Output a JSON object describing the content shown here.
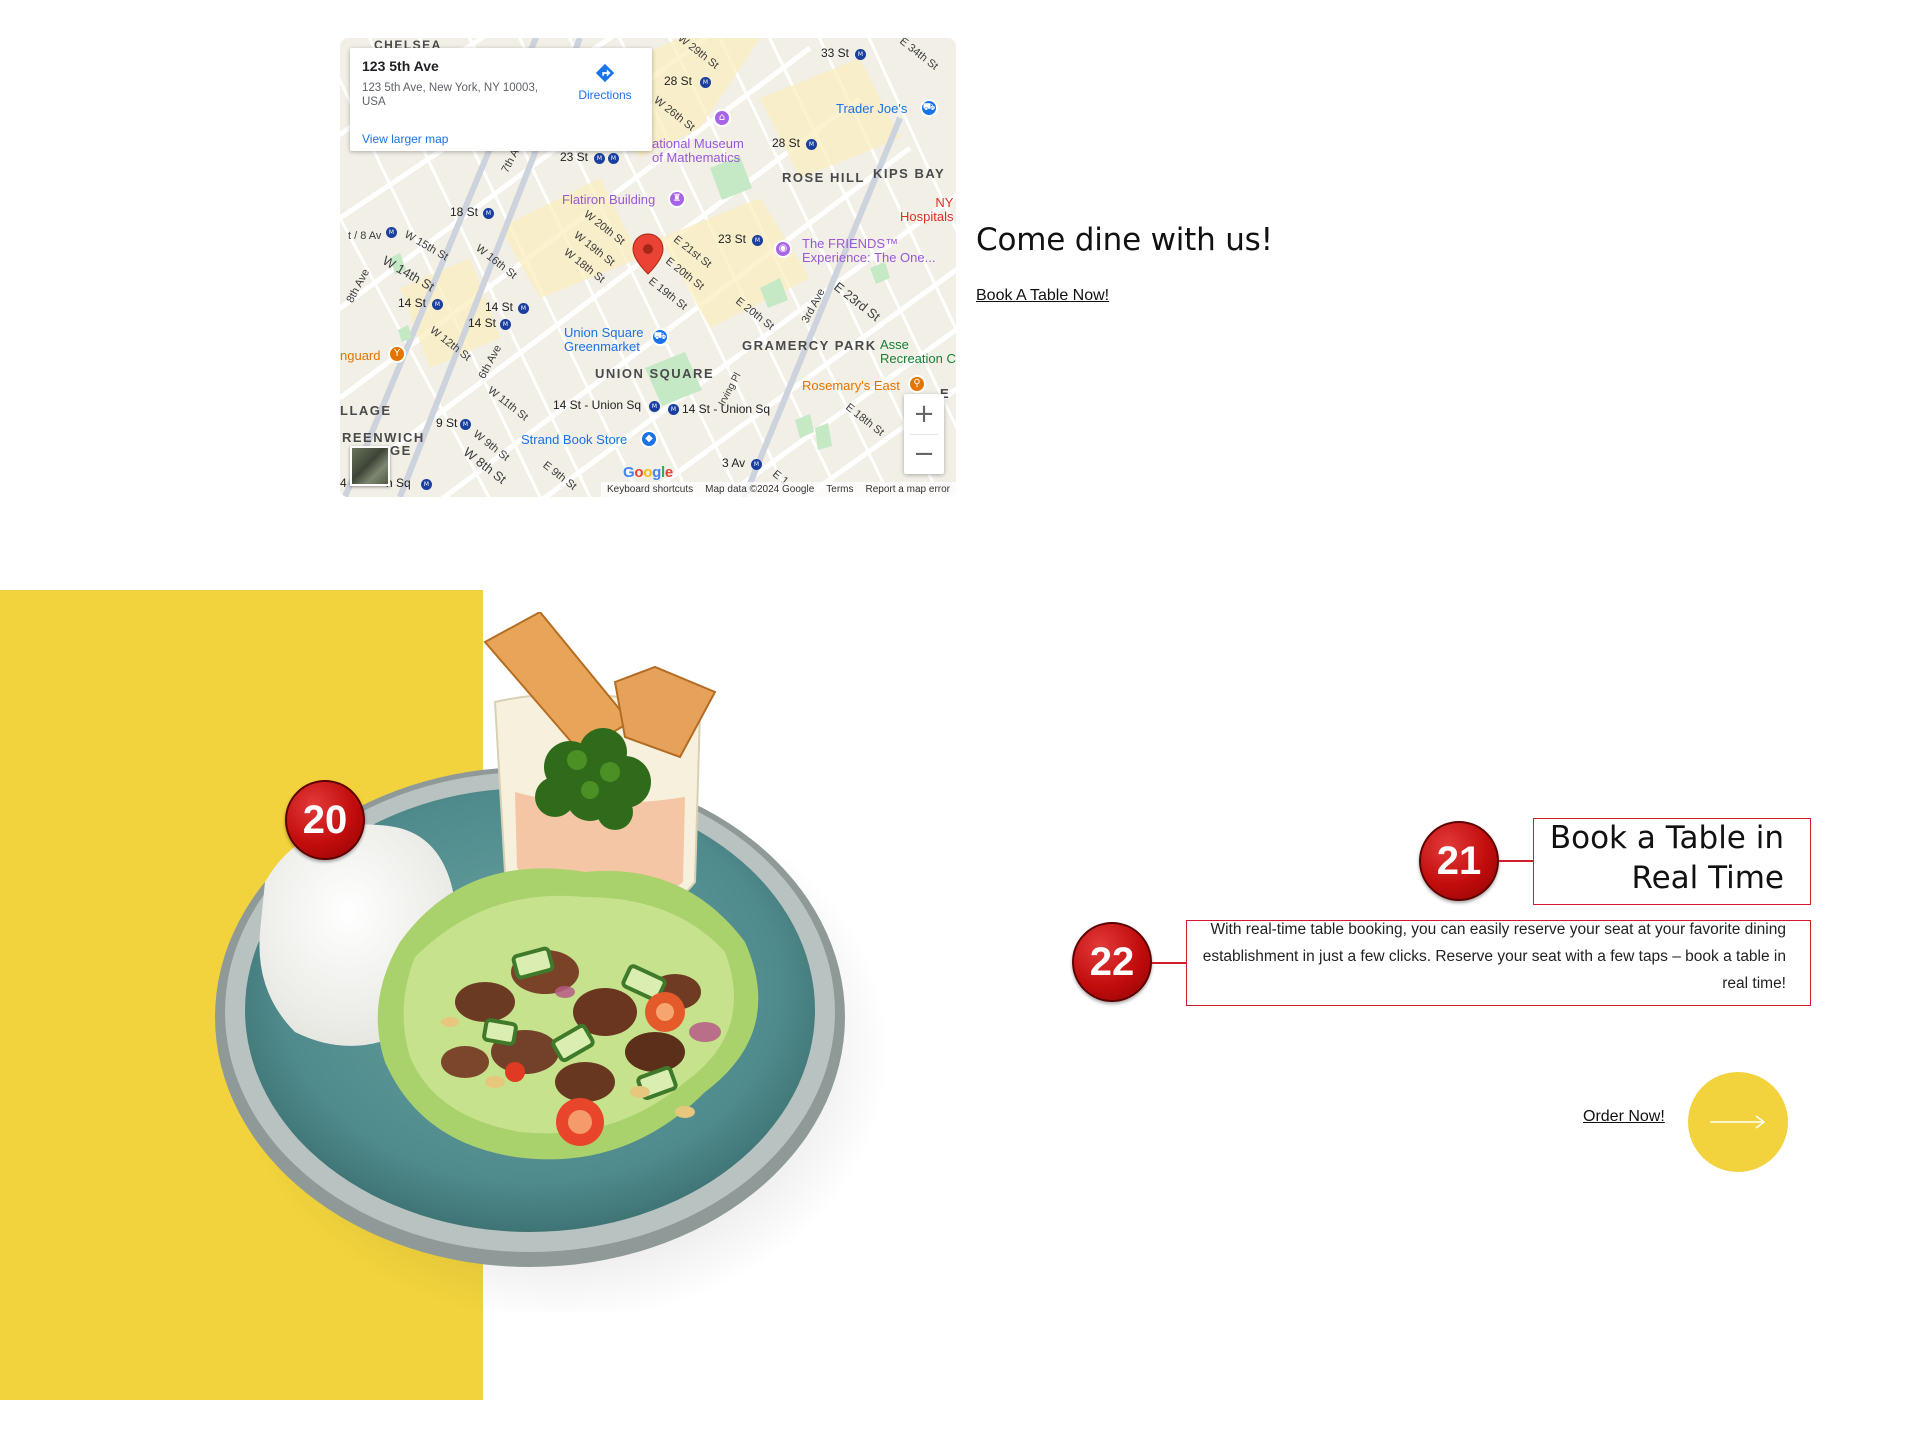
{
  "map": {
    "info_card": {
      "title": "123 5th Ave",
      "address": "123 5th Ave, New York, NY 10003, USA",
      "directions_label": "Directions",
      "view_larger_label": "View larger map"
    },
    "labels": {
      "chelsea": "CHELSEA",
      "rose_hill": "ROSE HILL",
      "kips_bay": "KIPS BAY",
      "gramercy_park": "GRAMERCY PARK",
      "union_square": "UNION SQUARE",
      "village": "LLAGE",
      "greenwich": "REENWICH",
      "greenwich_2": "GE",
      "w29": "W 29th St",
      "w26": "W 26th St",
      "e34": "E 34th St",
      "st28": "28 St",
      "st33": "33 St",
      "st28b": "28 St",
      "st23": "23 St",
      "st23b": "23 St",
      "st18": "18 St",
      "av8": "t / 8 Av",
      "w15": "W 15th St",
      "w14": "W 14th St",
      "w16": "W 16th St",
      "ave8": "8th Ave",
      "ave7": "7th Ave",
      "ave6": "6th Ave",
      "ave3": "3rd Ave",
      "w20": "W 20th St",
      "w19": "W 19th St",
      "w18": "W 18th St",
      "e21": "E 21st St",
      "e20": "E 20th St",
      "e19": "E 19th St",
      "e20b": "E 20th St",
      "e23": "E 23rd St",
      "e18": "E 18th St",
      "w12": "W 12th St",
      "w11": "W 11th St",
      "w9": "W 9th St",
      "w8": "W 8th St",
      "e9": "E 9th St",
      "e1": "E 1",
      "st14a": "14 St",
      "st14b": "14 St",
      "st14c": "14 St",
      "union14a": "14 St - Union Sq",
      "union14b": "14 St - Union Sq",
      "st9": "9 St",
      "av3": "3 Av",
      "sq4": "4 ",
      "sq4b": "h Sq",
      "irving": "Irving Pl",
      "trader_joes": "Trader Joe's",
      "museum": "ational Museum\nof Mathematics",
      "flatiron": "Flatiron Building",
      "friends": "The FRIENDS™\nExperience: The One...",
      "greenmarket": "Union Square\nGreenmarket",
      "strand": "Strand Book Store",
      "rosemarys": "Rosemary's East",
      "nyu": "NY\nHospitals",
      "asser": "Asse\nRecreation C",
      "vanguard": "nguard",
      "e_edge": "E"
    },
    "zoom_in": "+",
    "zoom_out": "−",
    "google": [
      "G",
      "o",
      "o",
      "g",
      "l",
      "e"
    ],
    "google_colors": [
      "#4285f4",
      "#ea4335",
      "#fbbc05",
      "#4285f4",
      "#34a853",
      "#ea4335"
    ],
    "footer": {
      "shortcuts": "Keyboard shortcuts",
      "data": "Map data ©2024 Google",
      "terms": "Terms",
      "report": "Report a map error"
    }
  },
  "dine": {
    "heading": "Come dine with us!",
    "link": "Book A Table Now!"
  },
  "booking": {
    "badge_image": "20",
    "badge_title": "21",
    "badge_desc": "22",
    "title": "Book a Table in Real Time",
    "description": "With real-time table booking, you can easily reserve your seat at your favorite dining establishment in just a few clicks. Reserve your seat with a few taps – book a table in real time!",
    "order_link": "Order Now!"
  },
  "colors": {
    "accent_yellow": "#f2d33d",
    "highlight_red": "#cf1b2b",
    "badge_red": "#c20c0c",
    "map_pin": "#ea4335",
    "plate": "#5f9a9a"
  }
}
